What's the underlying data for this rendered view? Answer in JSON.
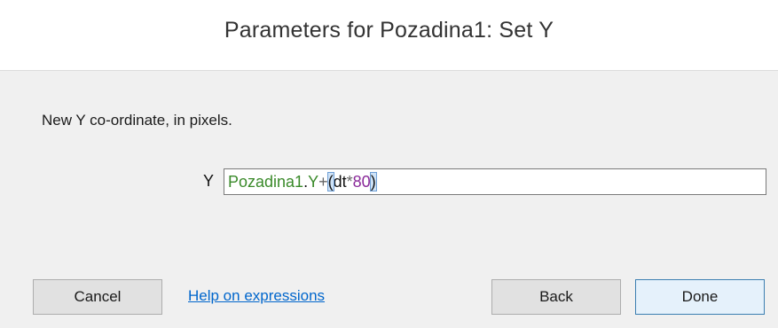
{
  "dialog": {
    "title": "Parameters for Pozadina1: Set Y"
  },
  "parameter": {
    "description": "New Y co-ordinate, in pixels.",
    "label": "Y",
    "expression_tokens": {
      "object": "Pozadina1",
      "dot": ".",
      "expression": "Y",
      "plus": "+",
      "open_paren": "(",
      "system": "dt",
      "times": "*",
      "number": "80",
      "close_paren": ")"
    }
  },
  "buttons": {
    "cancel": "Cancel",
    "help": "Help on expressions",
    "back": "Back",
    "done": "Done"
  }
}
